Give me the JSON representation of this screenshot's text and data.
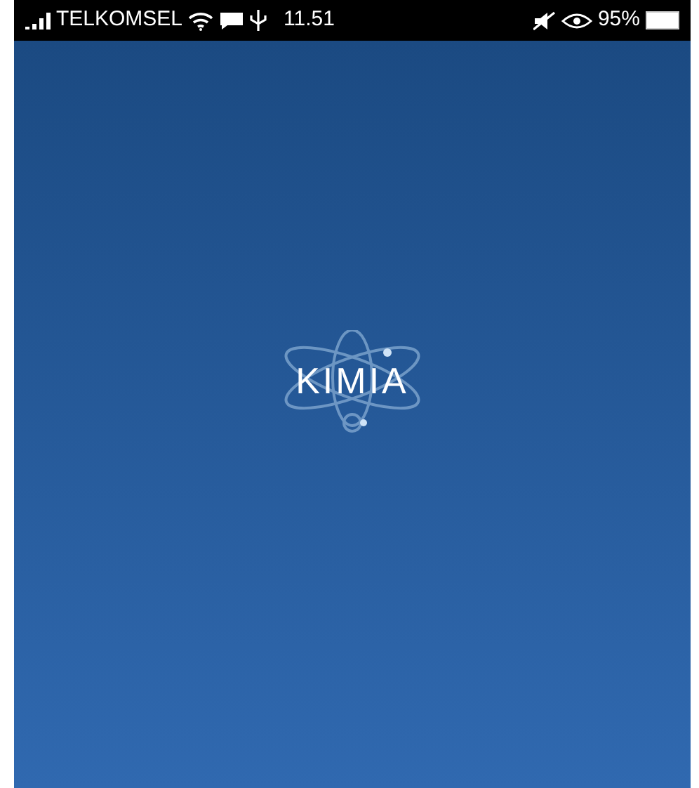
{
  "status_bar": {
    "carrier": "TELKOMSEL",
    "time": "11.51",
    "battery": "95%"
  },
  "splash": {
    "logo_text": "KIMIA"
  }
}
